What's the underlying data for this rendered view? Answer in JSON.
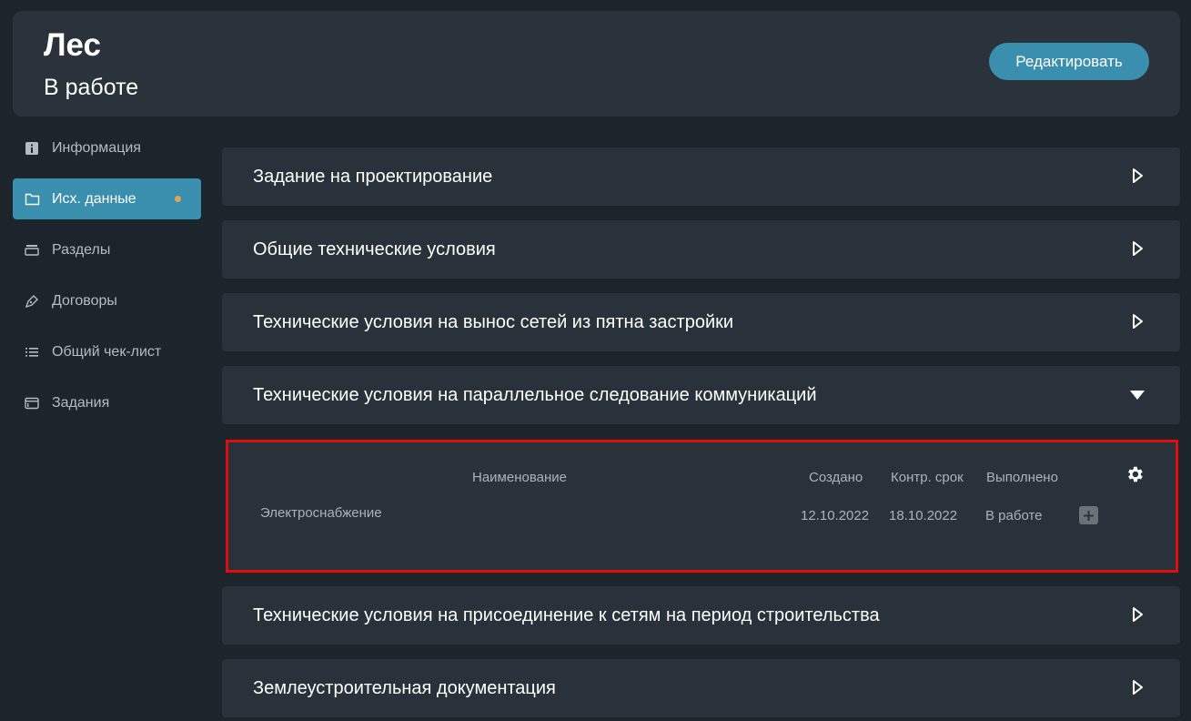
{
  "header": {
    "title": "Лес",
    "status": "В работе",
    "edit_label": "Редактировать"
  },
  "sidebar": {
    "items": [
      {
        "label": "Информация",
        "icon": "info-icon"
      },
      {
        "label": "Исх. данные",
        "icon": "folder-icon",
        "active": true
      },
      {
        "label": "Разделы",
        "icon": "sections-icon"
      },
      {
        "label": "Договоры",
        "icon": "pen-icon"
      },
      {
        "label": "Общий чек-лист",
        "icon": "checklist-icon"
      },
      {
        "label": "Задания",
        "icon": "tasks-icon"
      }
    ]
  },
  "sections": [
    {
      "title": "Задание на проектирование",
      "expanded": false
    },
    {
      "title": "Общие технические условия",
      "expanded": false
    },
    {
      "title": "Технические условия на вынос сетей из пятна застройки",
      "expanded": false
    },
    {
      "title": "Технические условия на параллельное следование коммуникаций",
      "expanded": true
    },
    {
      "title": "Технические условия на присоединение к сетям на период строительства",
      "expanded": false
    },
    {
      "title": "Землеустроительная документация",
      "expanded": false
    }
  ],
  "table": {
    "headers": {
      "name": "Наименование",
      "created": "Создано",
      "deadline": "Контр. срок",
      "done": "Выполнено"
    },
    "rows": [
      {
        "name": "Электроснабжение",
        "created": "12.10.2022",
        "deadline": "18.10.2022",
        "done": "В работе"
      }
    ]
  },
  "colors": {
    "accent": "#3a8fae",
    "background": "#1c242c",
    "panel": "#29323a",
    "highlight_border": "#e00d0d",
    "notification_dot": "#e0a552"
  }
}
